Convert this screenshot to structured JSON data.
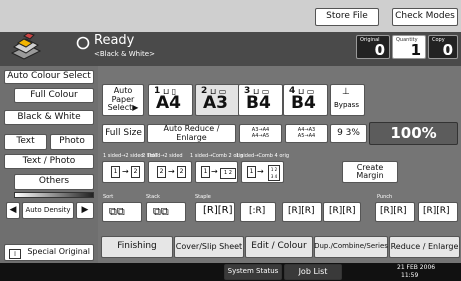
{
  "header": {
    "store_file": "Store File",
    "check_modes": "Check Modes",
    "status": "Ready",
    "status_sub": "<Black & White>"
  },
  "counters": {
    "original_label": "Original",
    "original_value": "0",
    "quantity_label": "Quantity",
    "quantity_value": "1",
    "copy_label": "Copy",
    "copy_value": "0"
  },
  "left_panel": {
    "auto_colour_select": "Auto Colour Select",
    "full_colour": "Full Colour",
    "black_white": "Black & White",
    "text": "Text",
    "photo": "Photo",
    "text_photo": "Text / Photo",
    "others": "Others",
    "auto_density": "Auto Density",
    "special_original": "Special Original"
  },
  "paper": {
    "auto_paper_select": "Auto Paper Select▶",
    "trays": [
      {
        "tray": "1",
        "size": "A4"
      },
      {
        "tray": "2",
        "size": "A3"
      },
      {
        "tray": "3",
        "size": "B4"
      },
      {
        "tray": "4",
        "size": "B4"
      }
    ],
    "bypass": "Bypass"
  },
  "reduce": {
    "full_size": "Full Size",
    "auto_reduce_enlarge": "Auto Reduce / Enlarge",
    "preset1_a": "A3→A4",
    "preset1_b": "A4→A5",
    "preset2_a": "A4→A3",
    "preset2_b": "A5→A4",
    "ratio_93": "9 3%",
    "ratio_display": "100%"
  },
  "duplex": {
    "label_1": "1 sided→2 sided: TtoT",
    "label_2": "2 sided→2 sided",
    "label_3": "1 sided→Comb 2 orig",
    "label_4": "1 sided→Comb 4 orig",
    "create_margin": "Create Margin"
  },
  "finishing_labels": {
    "sort": "Sort",
    "stack": "Stack",
    "staple": "Staple",
    "punch": "Punch"
  },
  "bottom_tabs": {
    "finishing": "Finishing",
    "cover_slip_sheet": "Cover/Slip Sheet",
    "edit_colour": "Edit / Colour",
    "dup_combine_series": "Dup./Combine/Series",
    "reduce_enlarge": "Reduce / Enlarge"
  },
  "footer": {
    "system_status": "System Status",
    "job_list": "Job List",
    "date": "21 FEB  2006",
    "time": "11:59"
  }
}
